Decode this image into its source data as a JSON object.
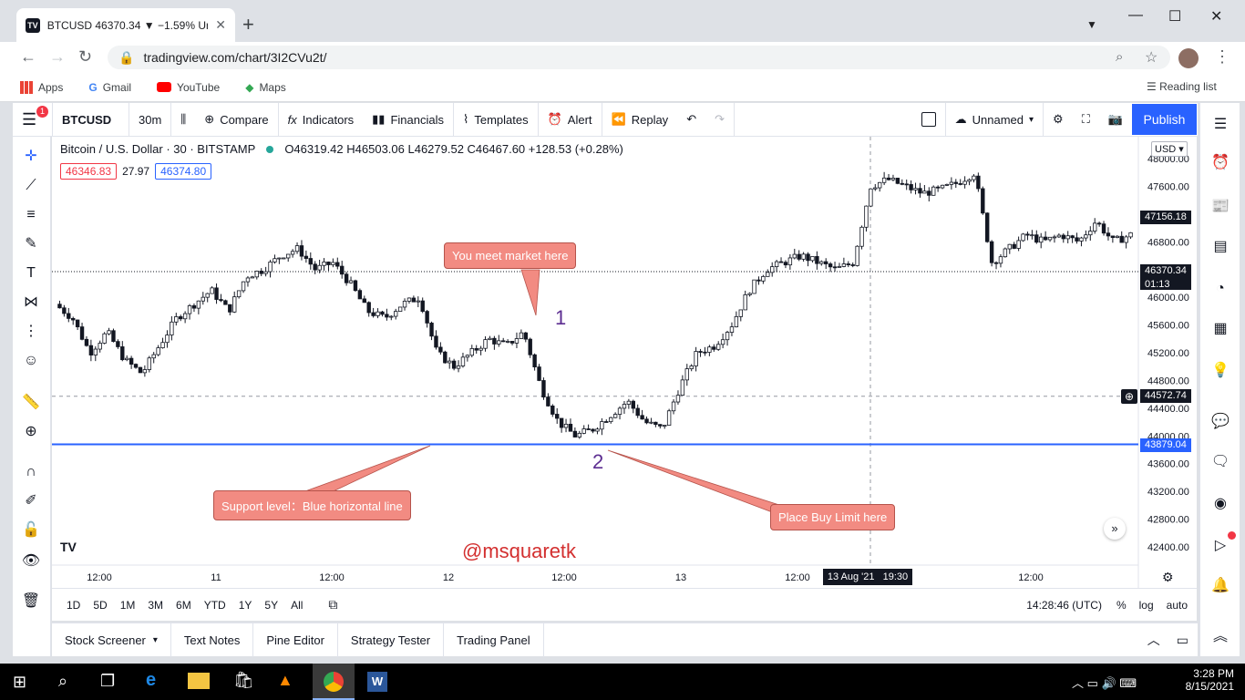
{
  "browser": {
    "tab_title": "BTCUSD 46370.34 ▼ −1.59% Unn",
    "url": "tradingview.com/chart/3I2CVu2t/",
    "bookmarks": [
      "Apps",
      "Gmail",
      "YouTube",
      "Maps"
    ],
    "reading_list": "Reading list"
  },
  "toolbar": {
    "symbol": "BTCUSD",
    "interval": "30m",
    "compare": "Compare",
    "indicators": "Indicators",
    "financials": "Financials",
    "templates": "Templates",
    "alert": "Alert",
    "replay": "Replay",
    "layout_name": "Unnamed",
    "publish": "Publish",
    "menu_badge": "1"
  },
  "legend": {
    "title": "Bitcoin / U.S. Dollar · 30 · BITSTAMP",
    "ohlc": "O46319.42 H46503.06 L46279.52 C46467.60 +128.53 (+0.28%)",
    "bid": "46346.83",
    "spread": "27.97",
    "ask": "46374.80"
  },
  "price_axis": {
    "currency": "USD",
    "ticks": [
      "48000.00",
      "47600.00",
      "47200.00",
      "46800.00",
      "46400.00",
      "46000.00",
      "45600.00",
      "45200.00",
      "44800.00",
      "44400.00",
      "44000.00",
      "43600.00",
      "43200.00",
      "42800.00",
      "42400.00"
    ],
    "labels": {
      "high": "47156.18",
      "last": "46370.34",
      "countdown": "01:13",
      "cross": "44572.74",
      "support": "43879.04"
    }
  },
  "time_axis": {
    "ticks": [
      "12:00",
      "11",
      "12:00",
      "12",
      "12:00",
      "13",
      "12:00",
      "12:00"
    ],
    "cursor": "13 Aug '21   19:30"
  },
  "annotations": {
    "callout_market": "You meet market here",
    "callout_support": "Support level：Blue horizontal line",
    "callout_buy": "Place Buy Limit here",
    "num1": "1",
    "num2": "2",
    "watermark": "@msquaretk"
  },
  "ranges": [
    "1D",
    "5D",
    "1M",
    "3M",
    "6M",
    "YTD",
    "1Y",
    "5Y",
    "All"
  ],
  "status": {
    "time": "14:28:46 (UTC)",
    "percent": "%",
    "log": "log",
    "auto": "auto"
  },
  "bottom_tabs": [
    "Stock Screener",
    "Text Notes",
    "Pine Editor",
    "Strategy Tester",
    "Trading Panel"
  ],
  "taskbar": {
    "time": "3:28 PM",
    "date": "8/15/2021"
  },
  "colors": {
    "up": "#ffffff",
    "down": "#131722",
    "support": "#2962ff",
    "accent": "#2962ff",
    "callout": "#f28b82"
  },
  "chart_data": {
    "type": "candlestick",
    "title": "Bitcoin / U.S. Dollar · 30 · BITSTAMP",
    "ylim": [
      42200,
      48200
    ],
    "support_level": 43879.04,
    "close_path": [
      45900,
      45700,
      45200,
      45500,
      45100,
      44900,
      45300,
      45700,
      45900,
      46100,
      45800,
      46300,
      46400,
      46600,
      46700,
      46400,
      46500,
      46200,
      45800,
      45700,
      45900,
      46000,
      45200,
      45000,
      45200,
      45400,
      45300,
      45500,
      44700,
      44200,
      44000,
      44100,
      44300,
      44500,
      44200,
      44100,
      44700,
      45200,
      45300,
      45600,
      46100,
      46400,
      46500,
      46600,
      46500,
      46400,
      46500,
      47600,
      47700,
      47600,
      47500,
      47550,
      47650,
      47800,
      46500,
      46700,
      46900,
      46800,
      46900,
      46800,
      47100,
      46800,
      46900
    ]
  }
}
